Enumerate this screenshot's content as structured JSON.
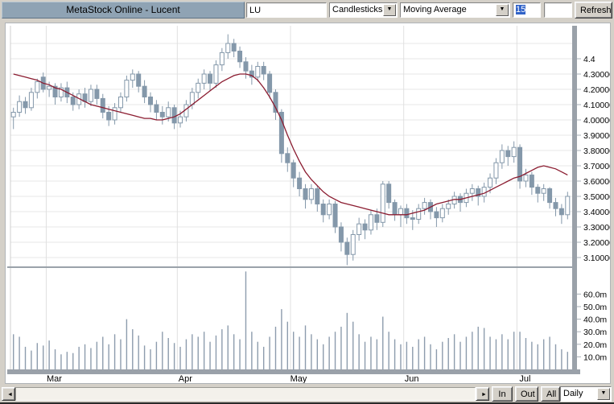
{
  "window": {
    "title": "MetaStock Online - Lucent"
  },
  "toolbar": {
    "symbol_input": "LU",
    "chart_type": {
      "value": "Candlesticks"
    },
    "indicator": {
      "value": "Moving Average"
    },
    "period_input": "15",
    "param_input": "",
    "refresh_label": "Refresh"
  },
  "bottombar": {
    "in_label": "In",
    "out_label": "Out",
    "all_label": "All",
    "interval": {
      "value": "Daily"
    }
  },
  "icons": {
    "dropdown_arrow": "▼",
    "scroll_left": "◄",
    "scroll_right": "►"
  },
  "chart_data": {
    "type": "candlestick",
    "symbol": "LU",
    "title": "MetaStock Online - Lucent",
    "legend_position": "none",
    "grid": true,
    "overlays": [
      {
        "type": "moving-average",
        "period": 15,
        "color": "#8b1c30"
      }
    ],
    "price_axis": {
      "side": "right",
      "ylim": [
        3.0,
        4.6
      ],
      "ticks": [
        {
          "v": 4.4,
          "label": "4.4"
        },
        {
          "v": 4.3,
          "label": "4.30000"
        },
        {
          "v": 4.2,
          "label": "4.20000"
        },
        {
          "v": 4.1,
          "label": "4.10000"
        },
        {
          "v": 4.0,
          "label": "4.00000"
        },
        {
          "v": 3.9,
          "label": "3.90000"
        },
        {
          "v": 3.8,
          "label": "3.80000"
        },
        {
          "v": 3.7,
          "label": "3.70000"
        },
        {
          "v": 3.6,
          "label": "3.60000"
        },
        {
          "v": 3.5,
          "label": "3.50000"
        },
        {
          "v": 3.4,
          "label": "3.40000"
        },
        {
          "v": 3.3,
          "label": "3.30000"
        },
        {
          "v": 3.2,
          "label": "3.20000"
        },
        {
          "v": 3.1,
          "label": "3.10000"
        }
      ]
    },
    "volume_axis": {
      "side": "right",
      "unit": "millions",
      "ticks": [
        {
          "v": 60,
          "label": "60.0m"
        },
        {
          "v": 50,
          "label": "50.0m"
        },
        {
          "v": 40,
          "label": "40.0m"
        },
        {
          "v": 30,
          "label": "30.0m"
        },
        {
          "v": 20,
          "label": "20.0m"
        },
        {
          "v": 10,
          "label": "10.0m"
        }
      ]
    },
    "x_axis": {
      "total_days": 94,
      "months": [
        {
          "label": "Mar",
          "start_day": 6
        },
        {
          "label": "Apr",
          "start_day": 28
        },
        {
          "label": "May",
          "start_day": 47
        },
        {
          "label": "Jun",
          "start_day": 66
        },
        {
          "label": "Jul",
          "start_day": 85
        }
      ]
    },
    "colors": {
      "candle": "#8498aa",
      "candle_up_fill": "#ffffff",
      "ma": "#8b1c30",
      "volume": "#8d9cad",
      "grid": "#e7e7e7",
      "axis_strip": "#9aa1a9"
    },
    "candles": [
      [
        4.02,
        4.08,
        3.94,
        4.05
      ],
      [
        4.05,
        4.16,
        4.02,
        4.12
      ],
      [
        4.12,
        4.15,
        4.04,
        4.08
      ],
      [
        4.08,
        4.21,
        4.06,
        4.18
      ],
      [
        4.18,
        4.27,
        4.14,
        4.25
      ],
      [
        4.28,
        4.31,
        4.18,
        4.2
      ],
      [
        4.2,
        4.25,
        4.15,
        4.22
      ],
      [
        4.22,
        4.24,
        4.1,
        4.15
      ],
      [
        4.15,
        4.24,
        4.12,
        4.21
      ],
      [
        4.21,
        4.25,
        4.11,
        4.15
      ],
      [
        4.15,
        4.18,
        4.06,
        4.1
      ],
      [
        4.1,
        4.2,
        4.07,
        4.17
      ],
      [
        4.17,
        4.21,
        4.08,
        4.12
      ],
      [
        4.12,
        4.23,
        4.09,
        4.2
      ],
      [
        4.2,
        4.23,
        4.1,
        4.14
      ],
      [
        4.14,
        4.17,
        4.01,
        4.05
      ],
      [
        4.05,
        4.09,
        3.96,
        4.0
      ],
      [
        4.0,
        4.11,
        3.97,
        4.08
      ],
      [
        4.08,
        4.18,
        4.05,
        4.15
      ],
      [
        4.15,
        4.29,
        4.12,
        4.26
      ],
      [
        4.26,
        4.33,
        4.21,
        4.3
      ],
      [
        4.3,
        4.32,
        4.18,
        4.22
      ],
      [
        4.22,
        4.26,
        4.11,
        4.15
      ],
      [
        4.15,
        4.18,
        4.05,
        4.1
      ],
      [
        4.1,
        4.13,
        4.0,
        4.05
      ],
      [
        4.05,
        4.09,
        3.97,
        4.02
      ],
      [
        4.02,
        4.12,
        3.99,
        4.08
      ],
      [
        4.08,
        4.1,
        3.94,
        3.98
      ],
      [
        3.98,
        4.06,
        3.95,
        4.02
      ],
      [
        4.02,
        4.13,
        3.99,
        4.1
      ],
      [
        4.1,
        4.21,
        4.07,
        4.18
      ],
      [
        4.18,
        4.27,
        4.14,
        4.24
      ],
      [
        4.24,
        4.33,
        4.2,
        4.3
      ],
      [
        4.3,
        4.32,
        4.19,
        4.24
      ],
      [
        4.24,
        4.39,
        4.21,
        4.36
      ],
      [
        4.36,
        4.47,
        4.32,
        4.44
      ],
      [
        4.44,
        4.56,
        4.4,
        4.5
      ],
      [
        4.5,
        4.53,
        4.41,
        4.45
      ],
      [
        4.45,
        4.48,
        4.34,
        4.38
      ],
      [
        4.38,
        4.41,
        4.27,
        4.32
      ],
      [
        4.32,
        4.36,
        4.23,
        4.28
      ],
      [
        4.28,
        4.38,
        4.25,
        4.35
      ],
      [
        4.35,
        4.38,
        4.26,
        4.3
      ],
      [
        4.3,
        4.32,
        4.14,
        4.18
      ],
      [
        4.18,
        4.2,
        4.0,
        4.05
      ],
      [
        4.05,
        4.07,
        3.72,
        3.78
      ],
      [
        3.78,
        3.82,
        3.66,
        3.72
      ],
      [
        3.72,
        3.74,
        3.56,
        3.62
      ],
      [
        3.62,
        3.66,
        3.5,
        3.55
      ],
      [
        3.55,
        3.58,
        3.42,
        3.48
      ],
      [
        3.48,
        3.58,
        3.45,
        3.55
      ],
      [
        3.55,
        3.57,
        3.4,
        3.45
      ],
      [
        3.45,
        3.48,
        3.33,
        3.38
      ],
      [
        3.38,
        3.48,
        3.35,
        3.45
      ],
      [
        3.45,
        3.47,
        3.26,
        3.3
      ],
      [
        3.3,
        3.33,
        3.14,
        3.2
      ],
      [
        3.2,
        3.23,
        3.05,
        3.12
      ],
      [
        3.12,
        3.28,
        3.08,
        3.25
      ],
      [
        3.25,
        3.36,
        3.21,
        3.32
      ],
      [
        3.32,
        3.35,
        3.22,
        3.28
      ],
      [
        3.28,
        3.41,
        3.25,
        3.38
      ],
      [
        3.38,
        3.42,
        3.28,
        3.33
      ],
      [
        3.33,
        3.6,
        3.3,
        3.58
      ],
      [
        3.58,
        3.6,
        3.42,
        3.46
      ],
      [
        3.46,
        3.48,
        3.34,
        3.38
      ],
      [
        3.38,
        3.44,
        3.3,
        3.42
      ],
      [
        3.42,
        3.45,
        3.32,
        3.36
      ],
      [
        3.36,
        3.41,
        3.28,
        3.35
      ],
      [
        3.35,
        3.45,
        3.32,
        3.42
      ],
      [
        3.42,
        3.49,
        3.38,
        3.46
      ],
      [
        3.46,
        3.48,
        3.35,
        3.4
      ],
      [
        3.4,
        3.43,
        3.3,
        3.36
      ],
      [
        3.36,
        3.45,
        3.33,
        3.42
      ],
      [
        3.42,
        3.48,
        3.38,
        3.45
      ],
      [
        3.45,
        3.53,
        3.42,
        3.5
      ],
      [
        3.5,
        3.52,
        3.4,
        3.46
      ],
      [
        3.46,
        3.55,
        3.43,
        3.52
      ],
      [
        3.52,
        3.58,
        3.47,
        3.55
      ],
      [
        3.55,
        3.57,
        3.44,
        3.5
      ],
      [
        3.5,
        3.59,
        3.46,
        3.56
      ],
      [
        3.56,
        3.65,
        3.52,
        3.62
      ],
      [
        3.62,
        3.75,
        3.58,
        3.72
      ],
      [
        3.72,
        3.84,
        3.68,
        3.8
      ],
      [
        3.8,
        3.83,
        3.7,
        3.76
      ],
      [
        3.76,
        3.86,
        3.72,
        3.82
      ],
      [
        3.82,
        3.84,
        3.55,
        3.6
      ],
      [
        3.6,
        3.68,
        3.56,
        3.64
      ],
      [
        3.64,
        3.66,
        3.51,
        3.56
      ],
      [
        3.56,
        3.58,
        3.46,
        3.52
      ],
      [
        3.52,
        3.58,
        3.47,
        3.55
      ],
      [
        3.55,
        3.56,
        3.42,
        3.46
      ],
      [
        3.46,
        3.49,
        3.37,
        3.42
      ],
      [
        3.42,
        3.45,
        3.32,
        3.38
      ],
      [
        3.38,
        3.53,
        3.35,
        3.5
      ]
    ],
    "ma15": [
      4.3,
      4.29,
      4.28,
      4.27,
      4.26,
      4.24,
      4.23,
      4.21,
      4.2,
      4.18,
      4.16,
      4.14,
      4.12,
      4.1,
      4.09,
      4.08,
      4.07,
      4.06,
      4.05,
      4.04,
      4.03,
      4.02,
      4.01,
      4.01,
      4.0,
      4.0,
      4.01,
      4.02,
      4.04,
      4.07,
      4.1,
      4.13,
      4.16,
      4.19,
      4.22,
      4.25,
      4.27,
      4.29,
      4.3,
      4.3,
      4.29,
      4.26,
      4.21,
      4.15,
      4.08,
      4.0,
      3.9,
      3.81,
      3.73,
      3.66,
      3.61,
      3.57,
      3.53,
      3.5,
      3.48,
      3.46,
      3.45,
      3.44,
      3.43,
      3.42,
      3.41,
      3.4,
      3.39,
      3.38,
      3.38,
      3.38,
      3.38,
      3.39,
      3.4,
      3.41,
      3.43,
      3.45,
      3.46,
      3.47,
      3.48,
      3.48,
      3.49,
      3.5,
      3.51,
      3.52,
      3.54,
      3.56,
      3.58,
      3.6,
      3.62,
      3.63,
      3.65,
      3.67,
      3.69,
      3.7,
      3.69,
      3.68,
      3.66,
      3.64
    ],
    "volumes_m": [
      28,
      26,
      18,
      15,
      21,
      19,
      23,
      16,
      12,
      14,
      13,
      18,
      20,
      17,
      22,
      26,
      20,
      28,
      24,
      40,
      32,
      27,
      19,
      16,
      22,
      30,
      25,
      21,
      18,
      24,
      28,
      26,
      30,
      22,
      27,
      32,
      35,
      28,
      24,
      78,
      30,
      22,
      18,
      26,
      34,
      48,
      38,
      30,
      26,
      35,
      28,
      24,
      20,
      26,
      30,
      34,
      45,
      38,
      28,
      22,
      26,
      24,
      42,
      30,
      24,
      20,
      22,
      18,
      24,
      26,
      20,
      16,
      22,
      25,
      28,
      22,
      26,
      30,
      34,
      33,
      26,
      24,
      28,
      24,
      30,
      30,
      25,
      22,
      20,
      24,
      26,
      20,
      16,
      14
    ]
  }
}
